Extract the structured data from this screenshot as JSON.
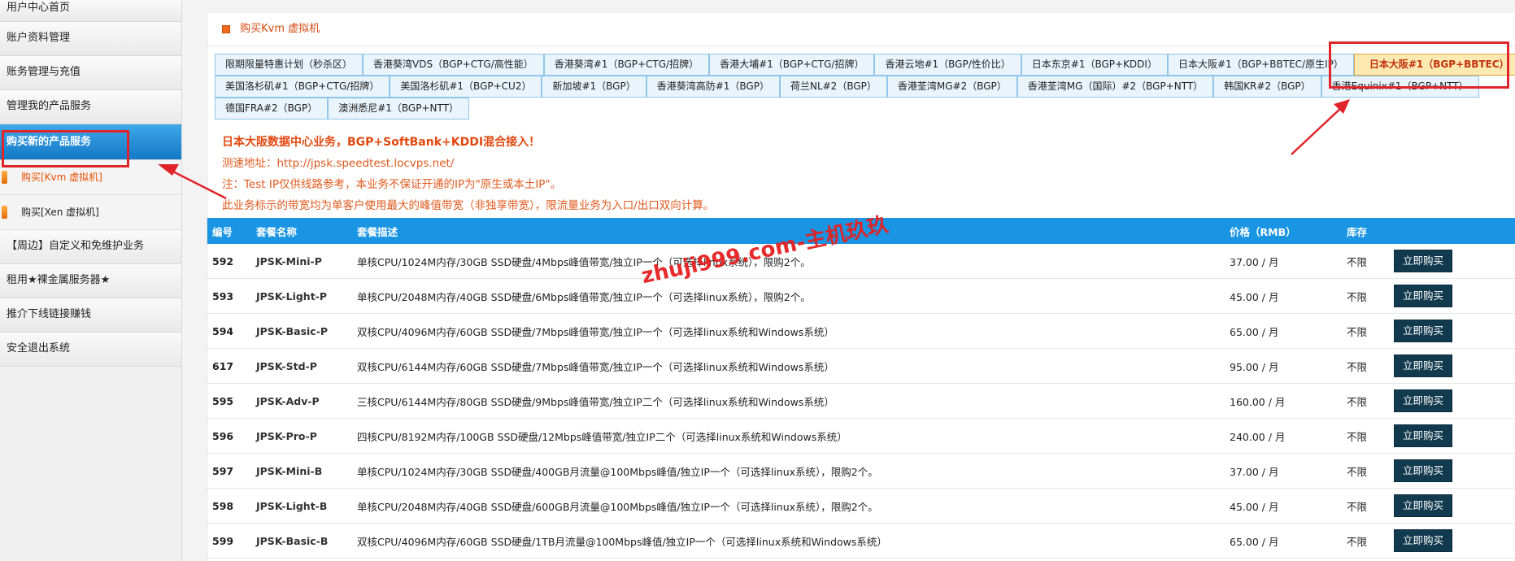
{
  "sidebar": {
    "items": [
      {
        "label": "用户中心首页"
      },
      {
        "label": "账户资料管理"
      },
      {
        "label": "账务管理与充值"
      },
      {
        "label": "管理我的产品服务"
      },
      {
        "label": "购买新的产品服务"
      }
    ],
    "sub_items": [
      {
        "label": "购买[Kvm 虚拟机]"
      },
      {
        "label": "购买[Xen 虚拟机]"
      }
    ],
    "more_items": [
      {
        "label": "【周边】自定义和免维护业务"
      },
      {
        "label": "租用★裸金属服务器★"
      },
      {
        "label": "推介下线链接赚钱"
      },
      {
        "label": "安全退出系统"
      }
    ]
  },
  "panel": {
    "title": "购买Kvm 虚拟机"
  },
  "tabs": {
    "row1": [
      "限期限量特惠计划（秒杀区）",
      "香港葵湾VDS（BGP+CTG/高性能）",
      "香港葵湾#1（BGP+CTG/招牌）",
      "香港大埔#1（BGP+CTG/招牌）",
      "香港云地#1（BGP/性价比）",
      "日本东京#1（BGP+KDDI）",
      "日本大阪#1（BGP+BBTEC/原生IP）",
      "日本大阪#1（BGP+BBTEC）"
    ],
    "row2": [
      "美国洛杉矶#1（BGP+CTG/招牌）",
      "美国洛杉矶#1（BGP+CU2）",
      "新加坡#1（BGP）",
      "香港葵湾高防#1（BGP）",
      "荷兰NL#2（BGP）",
      "香港荃湾MG#2（BGP）",
      "香港荃湾MG（国际）#2（BGP+NTT）",
      "韩国KR#2（BGP）",
      "香港Equinix#1（BGP+NTT）"
    ],
    "row3": [
      "德国FRA#2（BGP）",
      "澳洲悉尼#1（BGP+NTT）"
    ]
  },
  "info": {
    "headline": "日本大阪数据中心业务，BGP+SoftBank+KDDI混合接入！",
    "test_url": "测速地址：http://jpsk.speedtest.locvps.net/",
    "note1": "注：Test IP仅供线路参考，本业务不保证开通的IP为\"原生或本土IP\"。",
    "note2": "此业务标示的带宽均为单客户使用最大的峰值带宽（非独享带宽），限流量业务为入口/出口双向计算。"
  },
  "table": {
    "headers": [
      "编号",
      "套餐名称",
      "套餐描述",
      "价格（RMB）",
      "库存",
      ""
    ],
    "rows": [
      {
        "id": "592",
        "name": "JPSK-Mini-P",
        "desc": "单核CPU/1024M内存/30GB SSD硬盘/4Mbps峰值带宽/独立IP一个（可选择linux系统），限购2个。",
        "price": "37.00 / 月",
        "stock": "不限",
        "button": "立即购买"
      },
      {
        "id": "593",
        "name": "JPSK-Light-P",
        "desc": "单核CPU/2048M内存/40GB SSD硬盘/6Mbps峰值带宽/独立IP一个（可选择linux系统），限购2个。",
        "price": "45.00 / 月",
        "stock": "不限",
        "button": "立即购买"
      },
      {
        "id": "594",
        "name": "JPSK-Basic-P",
        "desc": "双核CPU/4096M内存/60GB SSD硬盘/7Mbps峰值带宽/独立IP一个（可选择linux系统和Windows系统）",
        "price": "65.00 / 月",
        "stock": "不限",
        "button": "立即购买"
      },
      {
        "id": "617",
        "name": "JPSK-Std-P",
        "desc": "双核CPU/6144M内存/60GB SSD硬盘/7Mbps峰值带宽/独立IP一个（可选择linux系统和Windows系统）",
        "price": "95.00 / 月",
        "stock": "不限",
        "button": "立即购买"
      },
      {
        "id": "595",
        "name": "JPSK-Adv-P",
        "desc": "三核CPU/6144M内存/80GB SSD硬盘/9Mbps峰值带宽/独立IP二个（可选择linux系统和Windows系统）",
        "price": "160.00 / 月",
        "stock": "不限",
        "button": "立即购买"
      },
      {
        "id": "596",
        "name": "JPSK-Pro-P",
        "desc": "四核CPU/8192M内存/100GB SSD硬盘/12Mbps峰值带宽/独立IP二个（可选择linux系统和Windows系统）",
        "price": "240.00 / 月",
        "stock": "不限",
        "button": "立即购买"
      },
      {
        "id": "597",
        "name": "JPSK-Mini-B",
        "desc": "单核CPU/1024M内存/30GB SSD硬盘/400GB月流量@100Mbps峰值/独立IP一个（可选择linux系统），限购2个。",
        "price": "37.00 / 月",
        "stock": "不限",
        "button": "立即购买"
      },
      {
        "id": "598",
        "name": "JPSK-Light-B",
        "desc": "单核CPU/2048M内存/40GB SSD硬盘/600GB月流量@100Mbps峰值/独立IP一个（可选择linux系统），限购2个。",
        "price": "45.00 / 月",
        "stock": "不限",
        "button": "立即购买"
      },
      {
        "id": "599",
        "name": "JPSK-Basic-B",
        "desc": "双核CPU/4096M内存/60GB SSD硬盘/1TB月流量@100Mbps峰值/独立IP一个（可选择linux系统和Windows系统）",
        "price": "65.00 / 月",
        "stock": "不限",
        "button": "立即购买"
      }
    ]
  },
  "watermark": "zhuji999.com-主机玖玖",
  "colors": {
    "accent": "#1a95e4",
    "highlight": "#e0242a",
    "active_tab_bg": "#fde9b1",
    "button_bg": "#123a4e"
  }
}
